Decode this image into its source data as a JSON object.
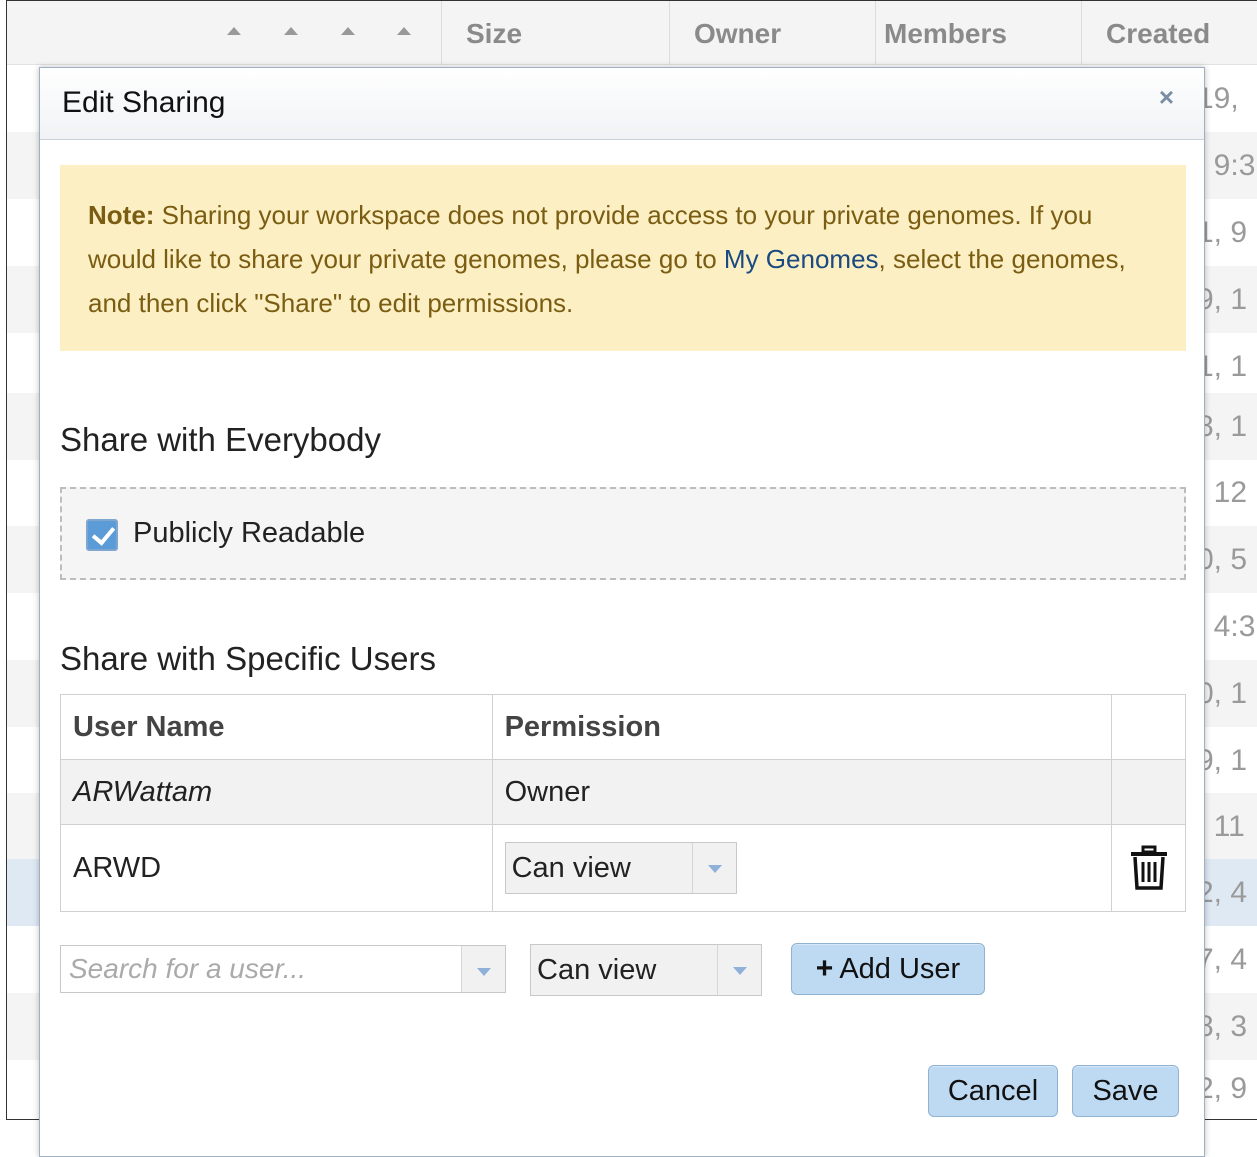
{
  "background_table": {
    "columns": [
      "Size",
      "Owner",
      "Members",
      "Created"
    ],
    "created_fragments": [
      "19,",
      ", 9:3",
      "1, 9",
      "9, 1",
      "1, 1",
      "8, 1",
      ", 12",
      "0, 5",
      ", 4:3",
      "0, 1",
      "9, 1",
      ", 11",
      "2, 4",
      "7, 4",
      "8, 3",
      "2, 9"
    ]
  },
  "modal": {
    "title": "Edit Sharing",
    "close_icon": "×",
    "note": {
      "label": "Note:",
      "text_1": " Sharing your workspace does not provide access to your private genomes. If you would like to share your private genomes, please go to ",
      "link": "My Genomes",
      "text_2": ", select the genomes, and then click \"Share\" to edit permissions."
    },
    "share_everybody": {
      "title": "Share with Everybody",
      "checkbox_label": "Publicly Readable",
      "checked": true
    },
    "share_users": {
      "title": "Share with Specific Users",
      "headers": {
        "user": "User Name",
        "permission": "Permission"
      },
      "owner_row": {
        "user": "ARWattam",
        "permission": "Owner"
      },
      "user_rows": [
        {
          "user": "ARWD",
          "permission": "Can view"
        }
      ]
    },
    "add_user": {
      "search_placeholder": "Search for a user...",
      "permission": "Can view",
      "button_label": "Add User",
      "button_icon": "+"
    },
    "footer": {
      "cancel_label": "Cancel",
      "save_label": "Save"
    }
  },
  "colors": {
    "note_bg": "#fcefc3",
    "note_text": "#7a5d12",
    "link": "#1a4a80",
    "button_bg": "#bed9f2",
    "selected_row": "#dfe9f3"
  }
}
